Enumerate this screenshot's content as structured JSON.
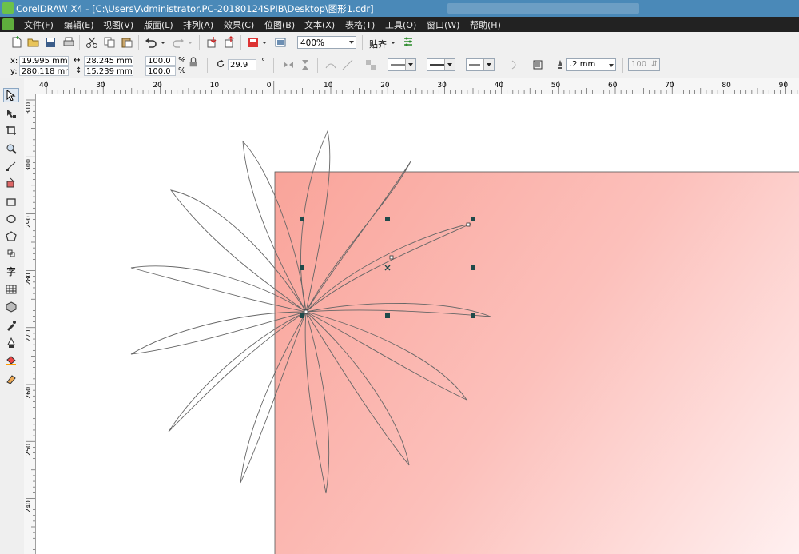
{
  "window": {
    "title": "CorelDRAW X4 - [C:\\Users\\Administrator.PC-20180124SPIB\\Desktop\\图形1.cdr]"
  },
  "menu": [
    "文件(F)",
    "编辑(E)",
    "视图(V)",
    "版面(L)",
    "排列(A)",
    "效果(C)",
    "位图(B)",
    "文本(X)",
    "表格(T)",
    "工具(O)",
    "窗口(W)",
    "帮助(H)"
  ],
  "toolbar": {
    "zoom": "400%",
    "snap_label": "贴齐"
  },
  "properties": {
    "x_label": "x:",
    "y_label": "y:",
    "x_value": "19.995 mm",
    "y_value": "280.118 mm",
    "width_value": "28.245 mm",
    "height_value": "15.239 mm",
    "scale_x": "100.0",
    "scale_y": "100.0",
    "percent": "%",
    "rotation": "29.9",
    "degree": "°",
    "outline_width": ".2 mm",
    "opacity_value": "100"
  },
  "rulers": {
    "horizontal_ticks": [
      "40",
      "30",
      "20",
      "10",
      "0",
      "10",
      "20",
      "30",
      "40",
      "50",
      "60",
      "70",
      "80",
      "90"
    ],
    "vertical_ticks": [
      "310",
      "300",
      "290",
      "280",
      "270",
      "260",
      "250",
      "240"
    ]
  },
  "tools": [
    "pick-tool",
    "shape-tool",
    "crop-tool",
    "zoom-tool",
    "freehand-tool",
    "smart-fill-tool",
    "rectangle-tool",
    "ellipse-tool",
    "polygon-tool",
    "basic-shapes-tool",
    "text-tool",
    "table-tool",
    "interactive-tool",
    "eyedropper-tool",
    "outline-tool",
    "fill-tool",
    "interactive-fill-tool"
  ],
  "text_tool_glyph": "字",
  "colors": {
    "gradient_start": "#f9a49a",
    "gradient_end": "#fff0f0",
    "handle": "#1f4a4a",
    "petal_stroke": "#666666"
  }
}
